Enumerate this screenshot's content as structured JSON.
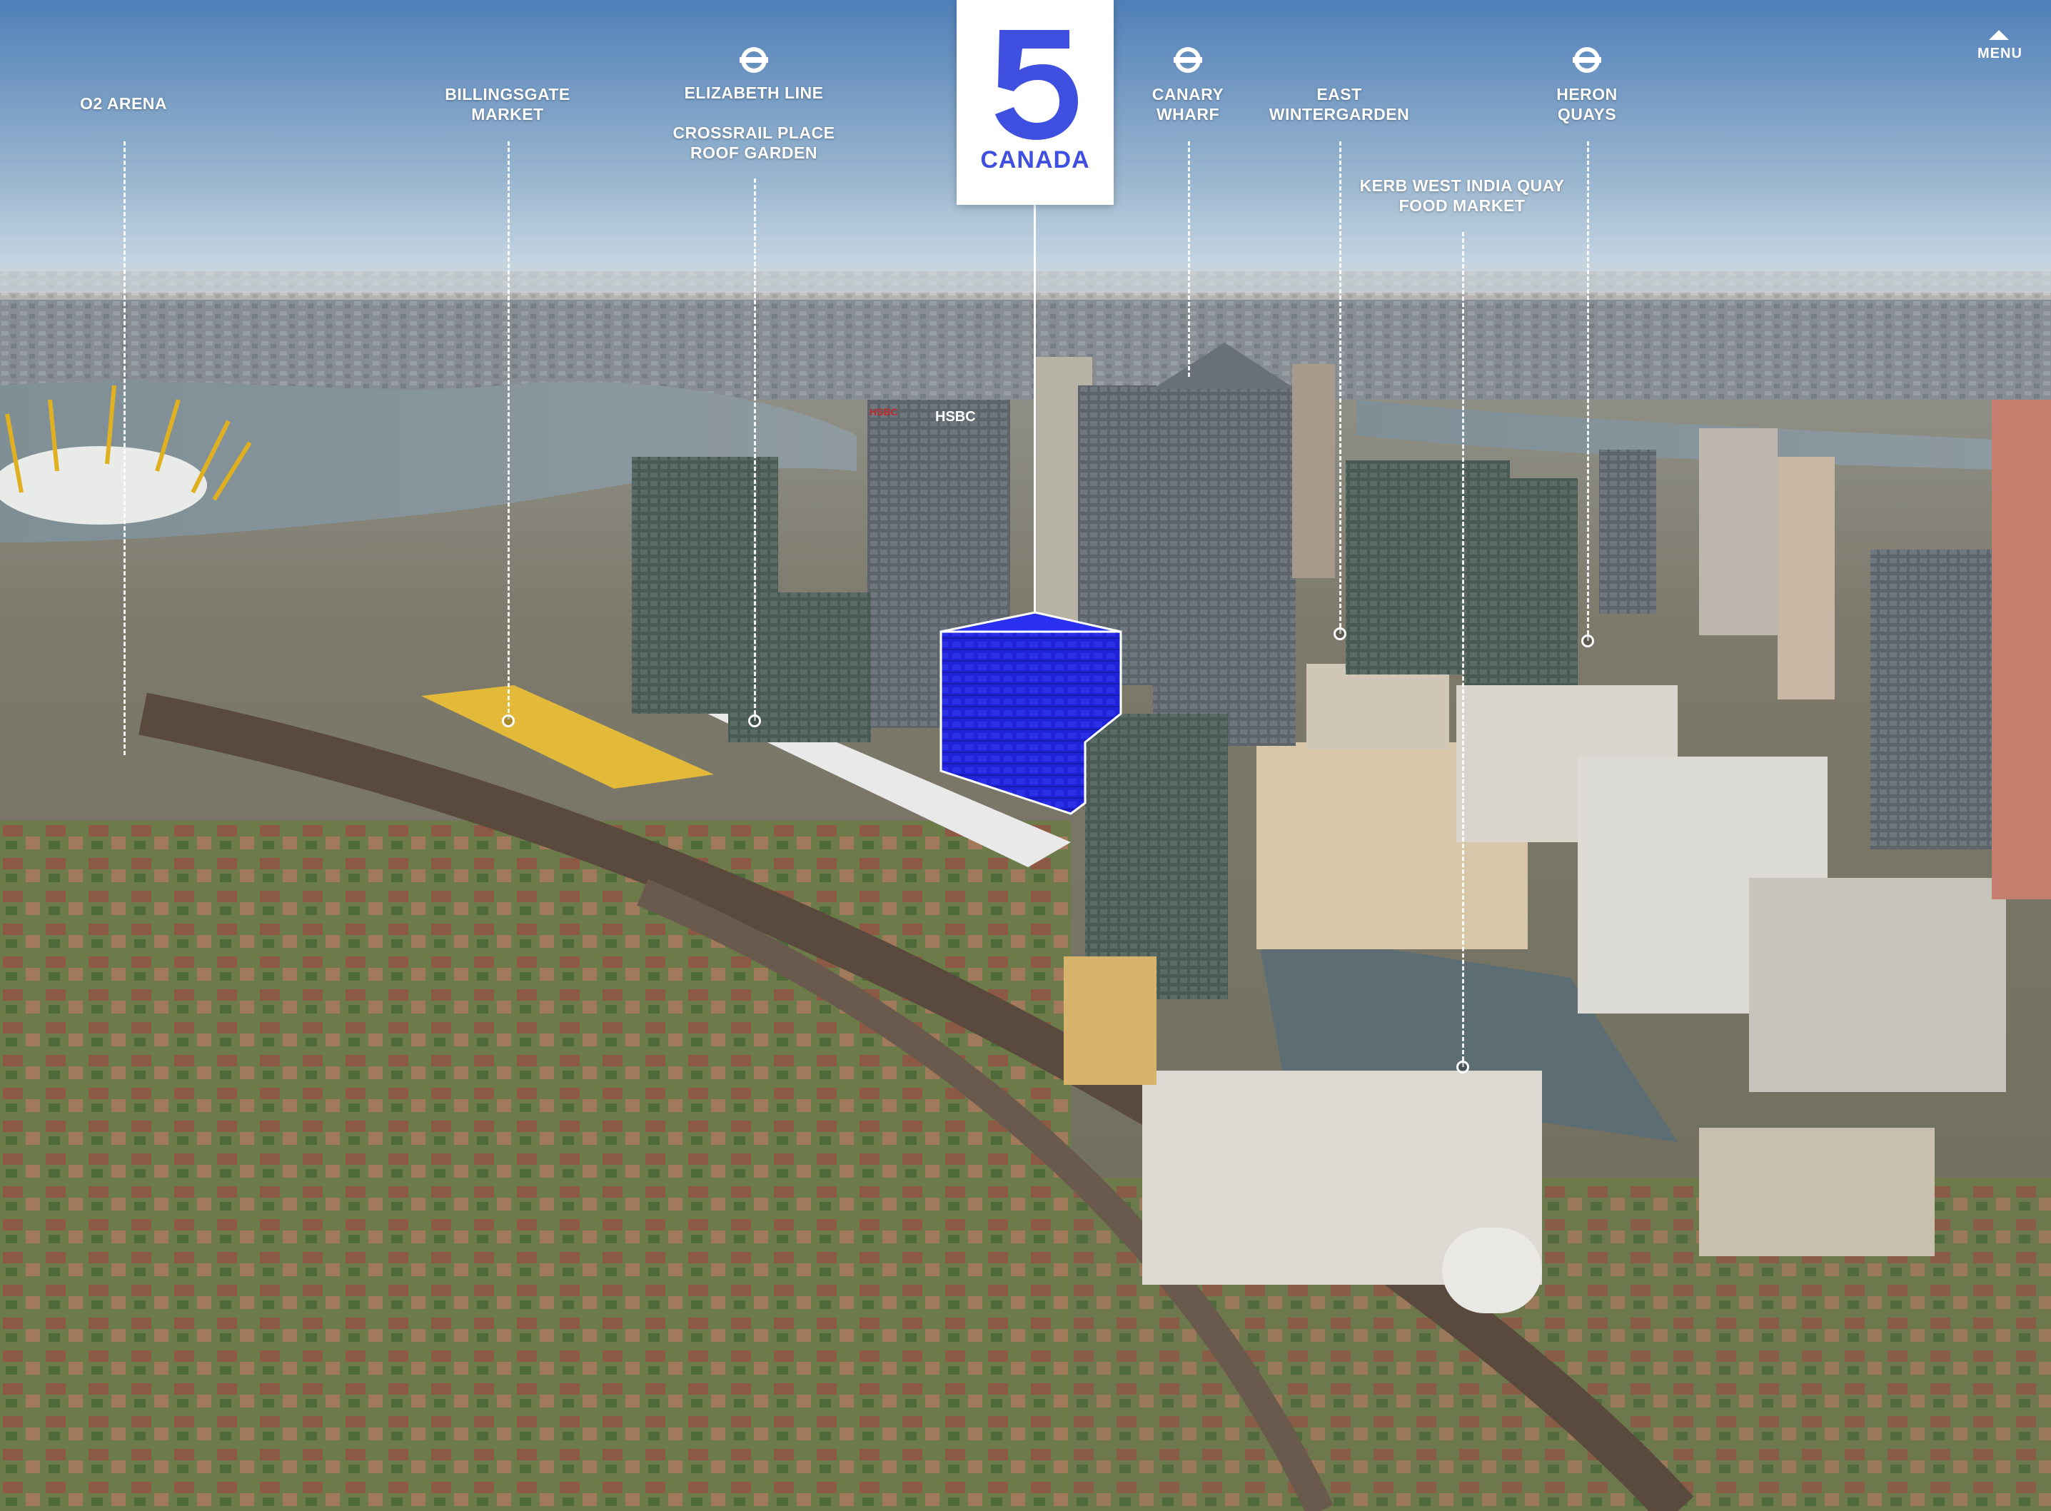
{
  "logo": {
    "numeral": "5",
    "name": "CANADA",
    "color": "#3f4fe0"
  },
  "menu": {
    "label": "MENU",
    "icon": "caret-up-icon"
  },
  "colors": {
    "highlight_building": "#1f22d6",
    "sky_top": "#4f7fb8",
    "sky_horizon": "#d7e2ea"
  },
  "locations": [
    {
      "id": "o2-arena",
      "line1": "O2 ARENA",
      "line2": "",
      "tube": false
    },
    {
      "id": "billingsgate",
      "line1": "BILLINGSGATE",
      "line2": "MARKET",
      "tube": false
    },
    {
      "id": "elizabeth-line",
      "line1": "ELIZABETH LINE",
      "line2": "",
      "tube": true
    },
    {
      "id": "crossrail-place",
      "line1": "CROSSRAIL PLACE",
      "line2": "ROOF GARDEN",
      "tube": false
    },
    {
      "id": "canary-wharf",
      "line1": "CANARY",
      "line2": "WHARF",
      "tube": true
    },
    {
      "id": "east-wintergarden",
      "line1": "EAST",
      "line2": "WINTERGARDEN",
      "tube": false
    },
    {
      "id": "kerb",
      "line1": "KERB WEST INDIA QUAY",
      "line2": "FOOD MARKET",
      "tube": false
    },
    {
      "id": "heron-quays",
      "line1": "HERON",
      "line2": "QUAYS",
      "tube": true
    }
  ],
  "signage": {
    "hsbc_left": "HSBC",
    "hsbc_right": "HSBC"
  }
}
